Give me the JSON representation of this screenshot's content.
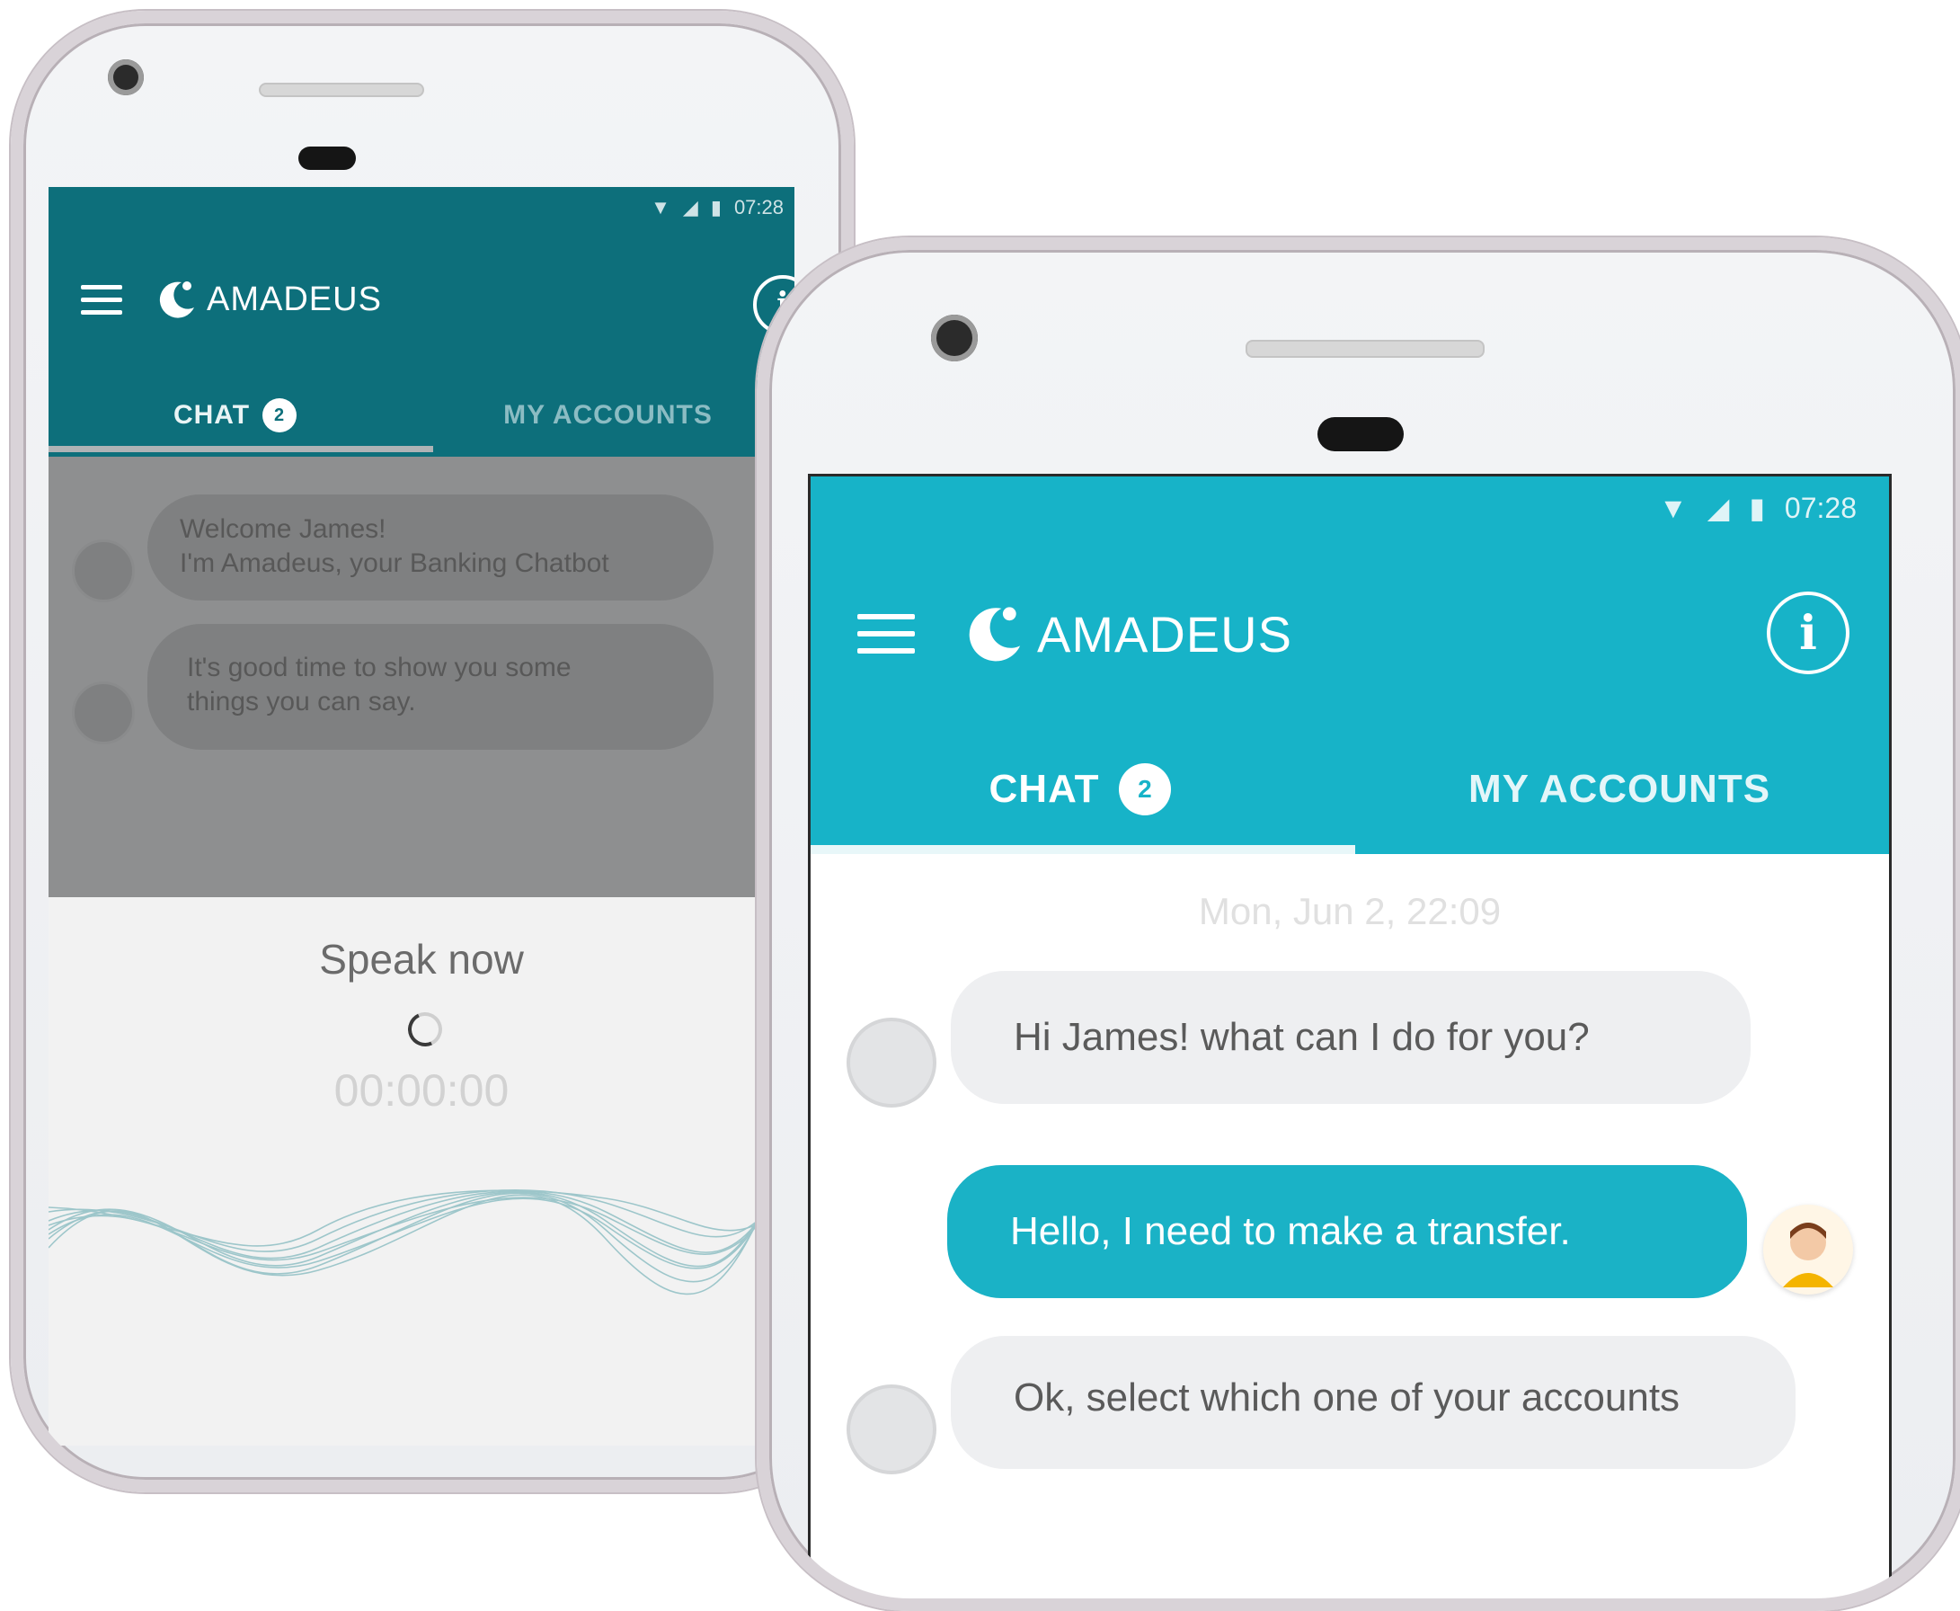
{
  "colors": {
    "left_header": "#0d6f7b",
    "left_dim": "#8e8f90",
    "right_header": "#17b3c8",
    "user_bubble": "#1ab2c6",
    "bot_bubble": "#eeeff1"
  },
  "left_phone": {
    "status_time": "07:28",
    "app_name": "AMADEUS",
    "tabs": [
      {
        "label": "CHAT",
        "badge": "2"
      },
      {
        "label": "MY ACCOUNTS"
      }
    ],
    "messages": [
      {
        "lines": [
          "Welcome James!",
          "I'm Amadeus, your Banking Chatbot"
        ]
      },
      {
        "lines": [
          "It's good time to show you some",
          "things you can say."
        ]
      }
    ],
    "voice": {
      "title": "Speak now",
      "timer": "00:00:00"
    }
  },
  "right_phone": {
    "status_time": "07:28",
    "app_name": "AMADEUS",
    "tabs": [
      {
        "label": "CHAT",
        "badge": "2"
      },
      {
        "label": "MY ACCOUNTS"
      }
    ],
    "date_separator": "Mon, Jun 2, 22:09",
    "messages": [
      {
        "from": "bot",
        "text": "Hi James! what can I do for you?"
      },
      {
        "from": "user",
        "text": "Hello, I need to make a transfer."
      },
      {
        "from": "bot",
        "text": "Ok, select which one of your accounts"
      }
    ]
  },
  "icons": [
    "wifi-icon",
    "signal-icon",
    "battery-icon",
    "menu-icon",
    "amadeus-logo-icon",
    "info-icon",
    "bot-avatar-icon",
    "user-avatar-icon",
    "spinner-icon",
    "mic-button-icon"
  ]
}
